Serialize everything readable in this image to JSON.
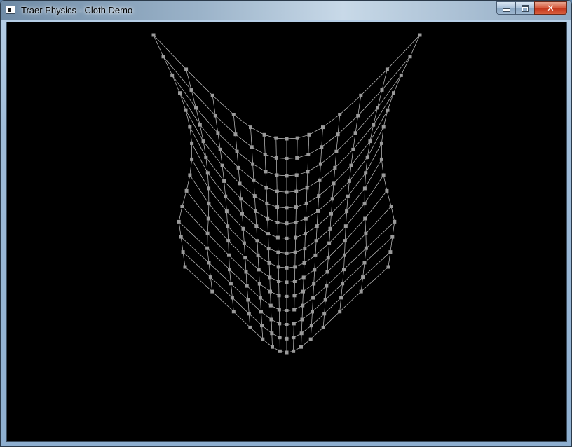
{
  "window": {
    "title": "Traer Physics - Cloth Demo",
    "icons": {
      "app": "application-icon",
      "minimize": "minimize-icon",
      "maximize": "maximize-icon",
      "close": "close-icon"
    },
    "close_glyph": "✕"
  },
  "canvas": {
    "background": "#000000",
    "particle_color": "#9a9a9a",
    "spring_color": "#c8c8c8",
    "grid_rows": 15,
    "grid_cols": 15
  }
}
